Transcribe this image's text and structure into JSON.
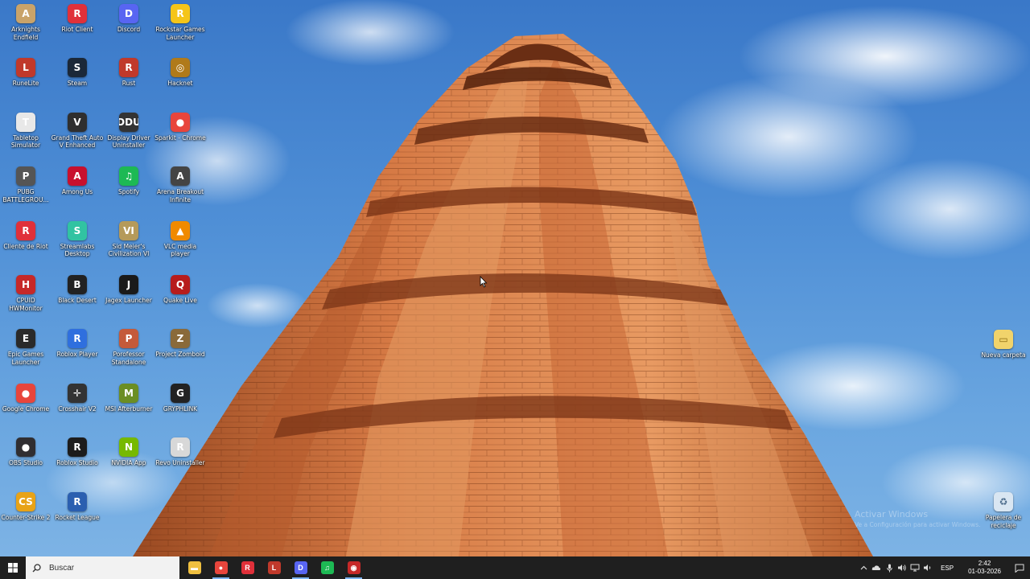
{
  "desktop": {
    "icons": [
      {
        "label": "Arknights Endfield",
        "glyph": "A",
        "color": "#c9a36a",
        "icon": "arknights-icon"
      },
      {
        "label": "Riot Client",
        "glyph": "R",
        "color": "#e0303a",
        "icon": "riot-client-icon"
      },
      {
        "label": "Discord",
        "glyph": "D",
        "color": "#5865f2",
        "icon": "discord-icon"
      },
      {
        "label": "Rockstar Games Launcher",
        "glyph": "R",
        "color": "#f5c518",
        "icon": "rockstar-icon"
      },
      {
        "label": "RuneLite",
        "glyph": "L",
        "color": "#c0392b",
        "icon": "runelite-icon"
      },
      {
        "label": "Steam",
        "glyph": "S",
        "color": "#1b2838",
        "icon": "steam-icon"
      },
      {
        "label": "Rust",
        "glyph": "R",
        "color": "#c0392b",
        "icon": "rust-icon"
      },
      {
        "label": "Hacknet",
        "glyph": "◎",
        "color": "#b07a1a",
        "icon": "hacknet-icon"
      },
      {
        "label": "Tabletop Simulator",
        "glyph": "T",
        "color": "#e8e8e8",
        "icon": "tabletop-simulator-icon"
      },
      {
        "label": "Grand Theft Auto V Enhanced",
        "glyph": "V",
        "color": "#2f2f2f",
        "icon": "gta-icon"
      },
      {
        "label": "Display Driver Uninstaller",
        "glyph": "DDU",
        "color": "#333333",
        "icon": "ddu-icon"
      },
      {
        "label": "Sparkit - Chrome",
        "glyph": "●",
        "color": "#e8453c",
        "icon": "chrome-app-icon"
      },
      {
        "label": "PUBG BATTLEGROU...",
        "glyph": "P",
        "color": "#555555",
        "icon": "pubg-icon"
      },
      {
        "label": "Among Us",
        "glyph": "A",
        "color": "#c8102e",
        "icon": "among-us-icon"
      },
      {
        "label": "Spotify",
        "glyph": "♫",
        "color": "#1db954",
        "icon": "spotify-icon"
      },
      {
        "label": "Arena Breakout Infinite",
        "glyph": "A",
        "color": "#444444",
        "icon": "arena-breakout-icon"
      },
      {
        "label": "Cliente de Riot",
        "glyph": "R",
        "color": "#e0303a",
        "icon": "riot-client-icon"
      },
      {
        "label": "Streamlabs Desktop",
        "glyph": "S",
        "color": "#31c3a2",
        "icon": "streamlabs-icon"
      },
      {
        "label": "Sid Meier's Civilization VI",
        "glyph": "VI",
        "color": "#b59a5a",
        "icon": "civilization-icon"
      },
      {
        "label": "VLC media player",
        "glyph": "▲",
        "color": "#f08a00",
        "icon": "vlc-icon"
      },
      {
        "label": "CPUID HWMonitor",
        "glyph": "H",
        "color": "#c62828",
        "icon": "hwmonitor-icon"
      },
      {
        "label": "Black Desert",
        "glyph": "B",
        "color": "#222222",
        "icon": "black-desert-icon"
      },
      {
        "label": "Jagex Launcher",
        "glyph": "J",
        "color": "#1a1a1a",
        "icon": "jagex-icon"
      },
      {
        "label": "Quake Live",
        "glyph": "Q",
        "color": "#b71c1c",
        "icon": "quake-icon"
      },
      {
        "label": "Epic Games Launcher",
        "glyph": "E",
        "color": "#2a2a2a",
        "icon": "epic-games-icon"
      },
      {
        "label": "Roblox Player",
        "glyph": "R",
        "color": "#2f6fde",
        "icon": "roblox-icon"
      },
      {
        "label": "Porofessor Standalone",
        "glyph": "P",
        "color": "#c45a3a",
        "icon": "porofessor-icon"
      },
      {
        "label": "Project Zomboid",
        "glyph": "Z",
        "color": "#8a6a3a",
        "icon": "project-zomboid-icon"
      },
      {
        "label": "Google Chrome",
        "glyph": "●",
        "color": "#e8453c",
        "icon": "chrome-icon"
      },
      {
        "label": "Crosshair V2",
        "glyph": "✛",
        "color": "#333333",
        "icon": "crosshair-icon"
      },
      {
        "label": "MSI Afterburner",
        "glyph": "M",
        "color": "#6b8e23",
        "icon": "msi-afterburner-icon"
      },
      {
        "label": "GRYPHLINK",
        "glyph": "G",
        "color": "#222222",
        "icon": "gryphlink-icon"
      },
      {
        "label": "OBS Studio",
        "glyph": "●",
        "color": "#302e31",
        "icon": "obs-icon"
      },
      {
        "label": "Roblox Studio",
        "glyph": "R",
        "color": "#1c1c1c",
        "icon": "roblox-studio-icon"
      },
      {
        "label": "NVIDIA App",
        "glyph": "N",
        "color": "#76b900",
        "icon": "nvidia-icon"
      },
      {
        "label": "Revo Uninstaller",
        "glyph": "R",
        "color": "#d8d8d8",
        "icon": "revo-uninstaller-icon"
      },
      {
        "label": "Counter-Strike 2",
        "glyph": "CS",
        "color": "#e8a317",
        "icon": "counter-strike-icon"
      },
      {
        "label": "Rocket League",
        "glyph": "R",
        "color": "#2b5fb0",
        "icon": "rocket-league-icon"
      }
    ],
    "right_icons": [
      {
        "label": "Nueva carpeta",
        "glyph": "▭",
        "color": "#f1d36b",
        "icon": "folder-icon"
      },
      {
        "label": "Papelera de reciclaje",
        "glyph": "♻",
        "color": "#d9e6f2",
        "icon": "recycle-bin-icon"
      }
    ],
    "watermark": {
      "line1": "Activar Windows",
      "line2": "Ve a Configuración para activar Windows."
    }
  },
  "taskbar": {
    "search_placeholder": "Buscar",
    "apps": [
      {
        "icon": "file-explorer-icon",
        "color": "#f0c040",
        "glyph": "▬",
        "active": false
      },
      {
        "icon": "chrome-icon",
        "color": "#e8453c",
        "glyph": "●",
        "active": true
      },
      {
        "icon": "riot-client-icon",
        "color": "#e0303a",
        "glyph": "R",
        "active": false
      },
      {
        "icon": "runelite-icon",
        "color": "#c0392b",
        "glyph": "L",
        "active": false
      },
      {
        "icon": "discord-icon",
        "color": "#5865f2",
        "glyph": "D",
        "active": true
      },
      {
        "icon": "spotify-icon",
        "color": "#1db954",
        "glyph": "♫",
        "active": false
      },
      {
        "icon": "overlay-app-icon",
        "color": "#c62828",
        "glyph": "◉",
        "active": true
      }
    ],
    "language": "ESP",
    "time": "2:42",
    "date": "01-03-2026"
  }
}
